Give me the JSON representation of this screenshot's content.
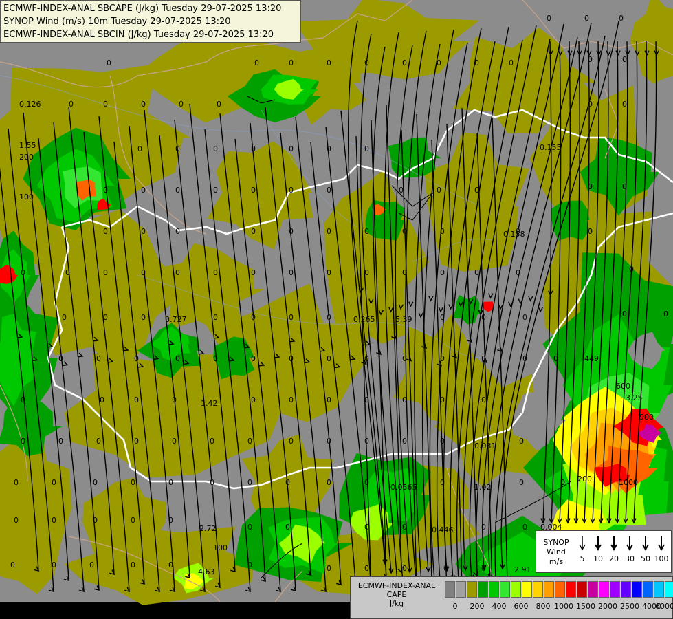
{
  "header": {
    "line1": "ECMWF-INDEX-ANAL SBCAPE (J/kg) Tuesday 29-07-2025 13:20",
    "line2": "SYNOP Wind (m/s) 10m Tuesday 29-07-2025 13:20",
    "line3": "ECMWF-INDEX-ANAL SBCIN (J/kg) Tuesday 29-07-2025 13:20"
  },
  "synop_legend": {
    "line1": "SYNOP",
    "line2": "Wind",
    "line3": "m/s",
    "items": [
      "5",
      "10",
      "20",
      "30",
      "50",
      "100"
    ]
  },
  "cape_legend": {
    "line1": "ECMWF-INDEX-ANAL",
    "line2": "CAPE",
    "line3": "J/kg",
    "colors": [
      "#808080",
      "#a0a0a0",
      "#9b9b00",
      "#00a000",
      "#00c800",
      "#32e632",
      "#9bff00",
      "#ffff00",
      "#ffd200",
      "#ffa000",
      "#ff6400",
      "#ff0000",
      "#c80000",
      "#c800a0",
      "#ff00ff",
      "#a000ff",
      "#6400ff",
      "#0000ff",
      "#0064ff",
      "#00c8ff",
      "#00ffff",
      "#ffffff"
    ],
    "tick_labels": [
      "0",
      "200",
      "400",
      "600",
      "800",
      "1000",
      "1500",
      "2000",
      "2500",
      "4000",
      "6000"
    ]
  },
  "map_labels": [
    "0",
    "0.126",
    "1.55",
    "200",
    "100",
    "0.727",
    "0.265",
    "5.39",
    "0.155",
    "0.158",
    "100",
    "1.42",
    "2.72",
    "4.63",
    "0.031",
    "1.02",
    "0.0565",
    "0.446",
    "0.004",
    "2.91",
    "3.25",
    "449",
    "900",
    "600",
    "1000",
    "200"
  ]
}
